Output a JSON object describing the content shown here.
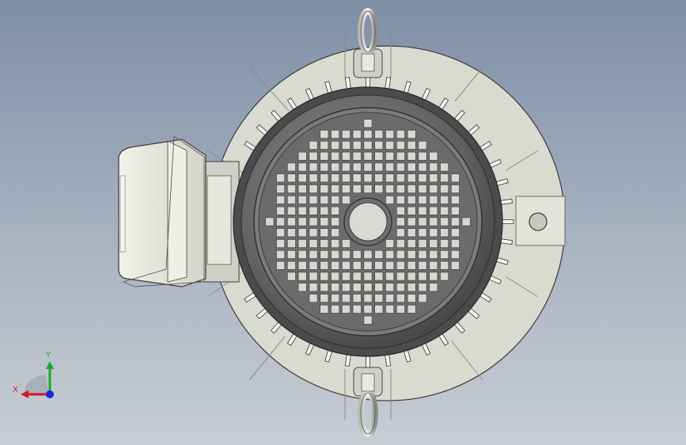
{
  "viewport": {
    "background_top": "#7f8fa6",
    "background_bottom": "#c8cdd4"
  },
  "model": {
    "flange_color": "#d9dbd1",
    "body_color": "#5a5c5c",
    "fan_cover_color": "#6a6b6b",
    "terminal_box_color": "#e4e6da",
    "grille_cell_color": "#d6d8d2",
    "grille_rows": 19,
    "grille_cols": 19
  },
  "triad": {
    "x_label": "X",
    "y_label": "Y",
    "x_color": "#d8141c",
    "y_color": "#1aa82a",
    "z_color": "#1a2ad8"
  }
}
